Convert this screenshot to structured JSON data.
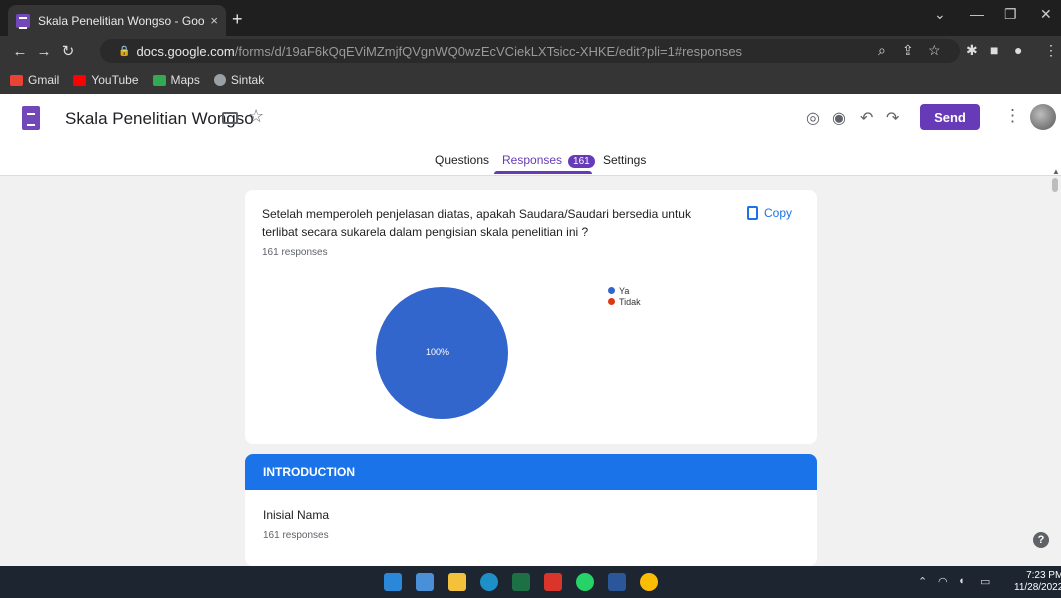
{
  "browser": {
    "tab_title": "Skala Penelitian Wongso - Googl",
    "tab_close": "×",
    "new_tab": "+",
    "url_host": "docs.google.com",
    "url_path": "/forms/d/19aF6kQqEViMZmjfQVgnWQ0wzEcVCiekLXTsicc-XHKE/edit?pli=1#responses",
    "bookmarks": [
      {
        "label": "Gmail",
        "icon": "gmail-icon",
        "color": "#ea4335"
      },
      {
        "label": "YouTube",
        "icon": "youtube-icon",
        "color": "#ff0000"
      },
      {
        "label": "Maps",
        "icon": "maps-icon",
        "color": "#34a853"
      },
      {
        "label": "Sintak",
        "icon": "globe-icon",
        "color": "#9aa0a6"
      }
    ]
  },
  "form": {
    "title": "Skala Penelitian Wongso",
    "send_label": "Send",
    "tabs": {
      "questions": "Questions",
      "responses": "Responses",
      "responses_count": "161",
      "settings": "Settings"
    }
  },
  "question_card": {
    "text": "Setelah memperoleh penjelasan diatas, apakah Saudara/Saudari bersedia untuk terlibat secara sukarela dalam pengisian skala penelitian ini ?",
    "response_count": "161 responses",
    "copy_label": "Copy"
  },
  "chart_data": {
    "type": "pie",
    "categories": [
      "Ya",
      "Tidak"
    ],
    "values": [
      100,
      0
    ],
    "slice_label": "100%",
    "colors": [
      "#3366cc",
      "#dc3912"
    ]
  },
  "section": {
    "title": "INTRODUCTION",
    "question": "Inisial Nama",
    "response_count": "161 responses"
  },
  "taskbar": {
    "time": "7:23 PM",
    "date": "11/28/2022"
  },
  "colors": {
    "accent": "#673ab7",
    "section_header": "#1a73e8"
  }
}
